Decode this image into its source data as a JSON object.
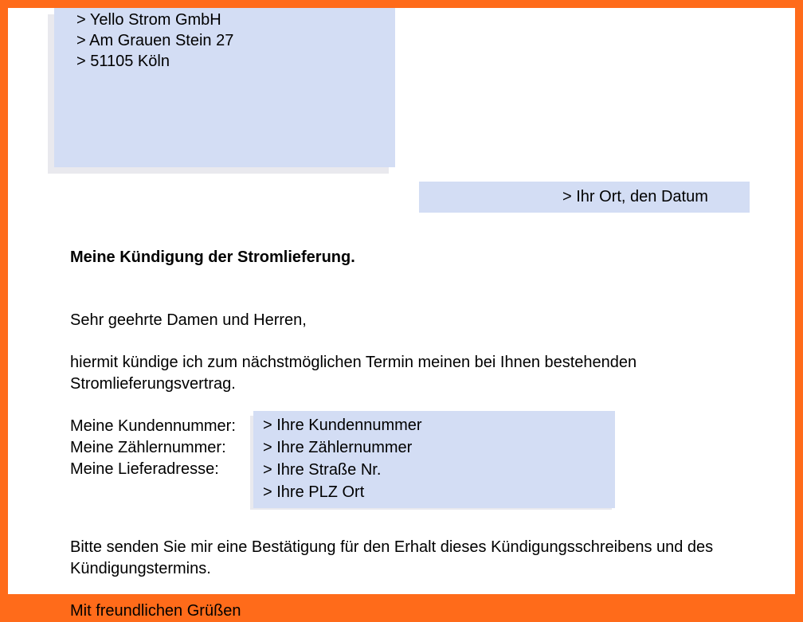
{
  "recipient": {
    "line1": "> Yello Strom GmbH",
    "line2": "> Am Grauen Stein 27",
    "line3": "> 51105 Köln"
  },
  "date_line": "> Ihr Ort, den Datum",
  "subject": "Meine Kündigung der Stromlieferung.",
  "salutation": "Sehr geehrte Damen und Herren,",
  "paragraph1": "hiermit kündige ich zum nächstmöglichen Termin meinen bei Ihnen bestehenden Stromlieferungsvertrag.",
  "fields": {
    "label_customer": "Meine Kundennummer:",
    "label_meter": "Meine Zählernummer:",
    "label_address": "Meine Lieferadresse:",
    "value_customer": "> Ihre Kundennummer",
    "value_meter": "> Ihre Zählernummer",
    "value_street": "> Ihre Straße Nr.",
    "value_city": "> Ihre PLZ Ort"
  },
  "paragraph2": "Bitte senden Sie mir eine Bestätigung für den Erhalt dieses Kündigungsschreibens und des Kündigungstermins.",
  "closing": "Mit freundlichen Grüßen"
}
